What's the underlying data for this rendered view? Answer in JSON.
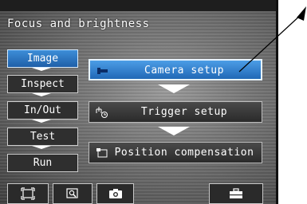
{
  "screen": {
    "title": "Focus and brightness"
  },
  "sidebar": {
    "items": [
      {
        "label": "Image",
        "active": true
      },
      {
        "label": "Inspect",
        "active": false
      },
      {
        "label": "In/Out",
        "active": false
      },
      {
        "label": "Test",
        "active": false
      },
      {
        "label": "Run",
        "active": false
      }
    ]
  },
  "main": {
    "buttons": [
      {
        "label": "Camera setup",
        "icon": "camera-setup-icon",
        "active": true
      },
      {
        "label": "Trigger setup",
        "icon": "trigger-icon",
        "active": false
      },
      {
        "label": "Position compensation",
        "icon": "position-compensation-icon",
        "active": false
      }
    ]
  },
  "toolbar": {
    "buttons": [
      {
        "icon": "fit-view-icon"
      },
      {
        "icon": "zoom-icon"
      },
      {
        "icon": "camera-icon"
      },
      {
        "icon": "toolbox-icon"
      }
    ]
  },
  "colors": {
    "active": "#2f7fd0",
    "background": "#6a6a6a",
    "text": "#ffffff"
  }
}
